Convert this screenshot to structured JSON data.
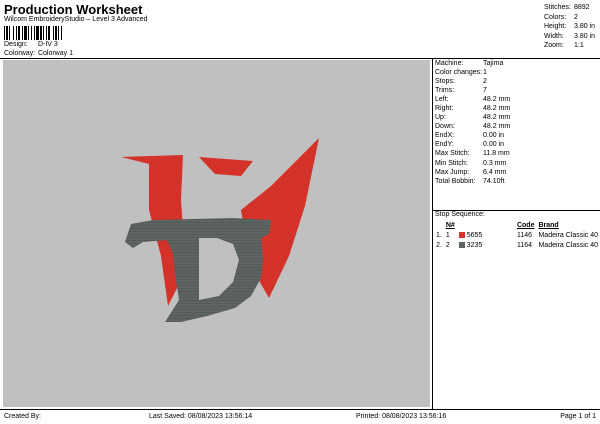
{
  "header": {
    "title": "Production Worksheet",
    "subtitle": "Wilcom EmbroideryStudio – Level 3 Advanced"
  },
  "design_info": [
    {
      "label": "Design:",
      "value": "D-IV 3"
    },
    {
      "label": "Colorway:",
      "value": "Colorway 1"
    }
  ],
  "summary": [
    {
      "label": "Stitches:",
      "value": "8892"
    },
    {
      "label": "Colors:",
      "value": "2"
    },
    {
      "label": "Height:",
      "value": "3.80 in"
    },
    {
      "label": "Width:",
      "value": "3.80 in"
    },
    {
      "label": "Zoom:",
      "value": "1:1"
    }
  ],
  "properties": [
    {
      "label": "Machine:",
      "value": "Tajima"
    },
    {
      "label": "Color changes:",
      "value": "1"
    },
    {
      "label": "Stops:",
      "value": "2"
    },
    {
      "label": "Trims:",
      "value": "7"
    },
    {
      "label": "Left:",
      "value": "48.2 mm"
    },
    {
      "label": "Right:",
      "value": "48.2 mm"
    },
    {
      "label": "Up:",
      "value": "48.2 mm"
    },
    {
      "label": "Down:",
      "value": "48.2 mm"
    },
    {
      "label": "EndX:",
      "value": "0.00 in"
    },
    {
      "label": "EndY:",
      "value": "0.00 in"
    },
    {
      "label": "Max Stitch:",
      "value": "11.8 mm"
    },
    {
      "label": "Min Stitch:",
      "value": "0.3 mm"
    },
    {
      "label": "Max Jump:",
      "value": "6.4 mm"
    },
    {
      "label": "Total Bobbin:",
      "value": "74.10ft"
    }
  ],
  "stop_sequence": {
    "title": "Stop Sequence:",
    "headers": [
      "N#",
      "Code",
      "Brand"
    ],
    "rows": [
      {
        "stop": "1.",
        "n": "1",
        "color": "#d8342c",
        "name": "5655",
        "code": "1146",
        "brand": "Madeira Classic 40"
      },
      {
        "stop": "2.",
        "n": "2",
        "color": "#5d6462",
        "name": "3235",
        "code": "1164",
        "brand": "Madeira Classic 40"
      }
    ]
  },
  "footer": {
    "created_by": "Created By:",
    "last_saved": "Last Saved: 08/08/2023 13:56:14",
    "printed": "Printed: 08/08/2023 13:56:16",
    "page": "Page 1 of 1"
  },
  "colors": {
    "canvas_bg": "#c0c0c0",
    "red_thread": "#d8342c",
    "gray_thread": "#5d6462"
  }
}
